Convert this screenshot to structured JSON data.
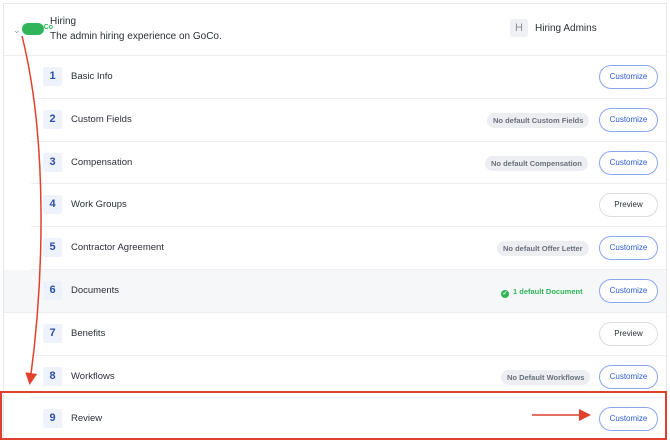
{
  "header": {
    "title": "Hiring",
    "subtitle": "The admin hiring experience on GoCo.",
    "logo_text": "GoCo",
    "owner_initial": "H",
    "owner_name": "Hiring Admins"
  },
  "steps": [
    {
      "number": "1",
      "label": "Basic Info",
      "badge": "",
      "button": "Customize"
    },
    {
      "number": "2",
      "label": "Custom Fields",
      "badge": "No default Custom Fields",
      "button": "Customize"
    },
    {
      "number": "3",
      "label": "Compensation",
      "badge": "No default Compensation",
      "button": "Customize"
    },
    {
      "number": "4",
      "label": "Work Groups",
      "badge": "",
      "button": "Preview"
    },
    {
      "number": "5",
      "label": "Contractor Agreement",
      "badge": "No default Offer Letter",
      "button": "Customize"
    },
    {
      "number": "6",
      "label": "Documents",
      "badge": "1 default Document",
      "button": "Customize"
    },
    {
      "number": "7",
      "label": "Benefits",
      "badge": "",
      "button": "Preview"
    },
    {
      "number": "8",
      "label": "Workflows",
      "badge": "No Default Workflows",
      "button": "Customize"
    },
    {
      "number": "9",
      "label": "Review",
      "badge": "",
      "button": "Customize"
    }
  ],
  "colors": {
    "accent": "#2d5bd6",
    "success": "#2fb45a",
    "annotation": "#e0402d"
  }
}
